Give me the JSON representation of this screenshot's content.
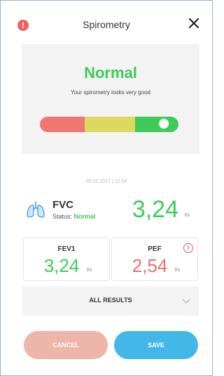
{
  "header": {
    "title": "Spirometry",
    "alert_icon": "!"
  },
  "result": {
    "status": "Normal",
    "subtitle": "Your spirometry looks very good",
    "scale_colors": [
      "#f27575",
      "#dcd95e",
      "#3ecb5a"
    ]
  },
  "measurement": {
    "timestamp": "26.02.2017 | 12:24",
    "fvc": {
      "label": "FVC",
      "status_prefix": "Status: ",
      "status": "Normal",
      "value": "3,24",
      "unit": "l/s"
    },
    "fev1": {
      "label": "FEV1",
      "value": "3,24",
      "unit": "l/s",
      "color": "#3ecb5a"
    },
    "pef": {
      "label": "PEF",
      "value": "2,54",
      "unit": "l/s",
      "color": "#e87070",
      "warning_icon": "!"
    }
  },
  "all_results": {
    "label": "ALL RESULTS"
  },
  "buttons": {
    "cancel": "CANCEL",
    "save": "SAVE"
  },
  "colors": {
    "green": "#3ecb5a",
    "red": "#e87070",
    "blue": "#43b7e8",
    "peach": "#eeb5a9"
  }
}
